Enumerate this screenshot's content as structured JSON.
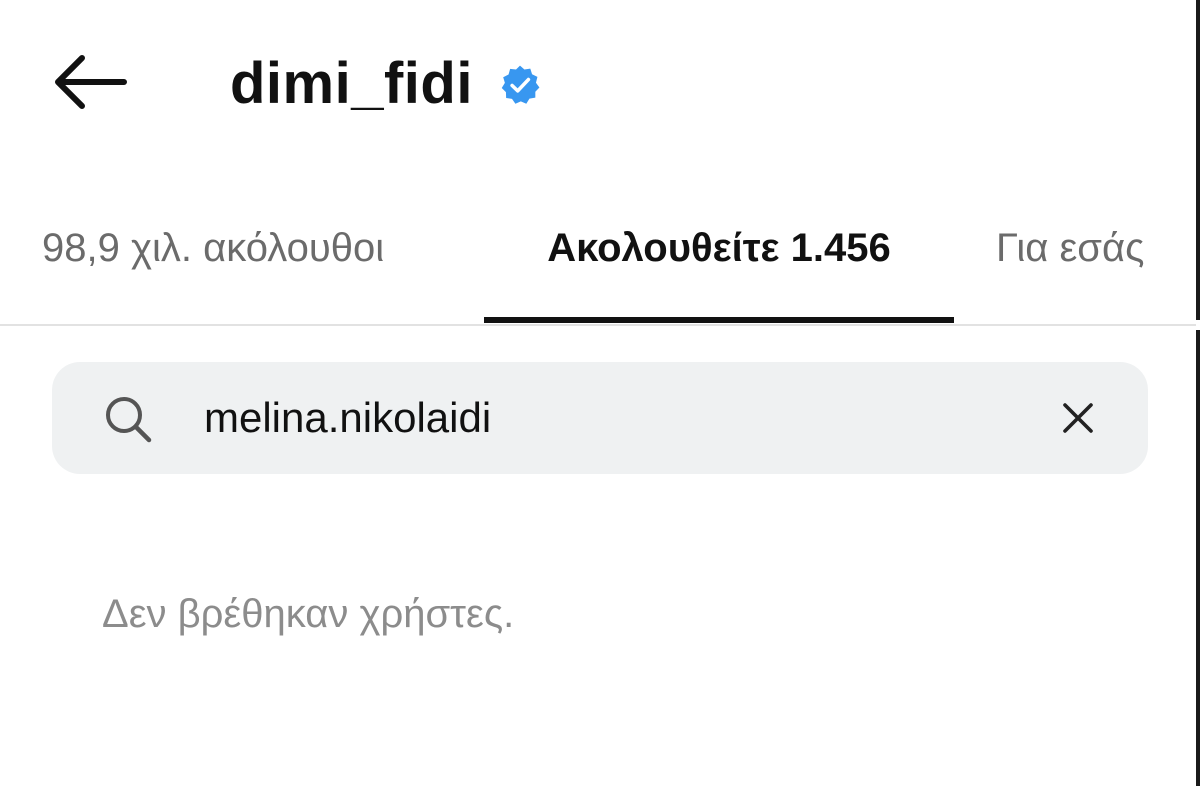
{
  "header": {
    "username": "dimi_fidi",
    "verified_icon": "verified-badge-icon",
    "back_icon": "arrow-left-icon"
  },
  "tabs": [
    {
      "label": "98,9 χιλ. ακόλουθοι",
      "active": false
    },
    {
      "label": "Ακολουθείτε 1.456",
      "active": true
    },
    {
      "label": "Για εσάς",
      "active": false
    }
  ],
  "search": {
    "icon": "search-icon",
    "value": "melina.nikolaidi",
    "clear_icon": "close-icon"
  },
  "results": {
    "empty_message": "Δεν βρέθηκαν χρήστες."
  },
  "colors": {
    "verified_blue": "#3897f0",
    "active_tab": "#111111",
    "inactive_tab": "#6b6b6b",
    "search_background": "#eff1f2",
    "empty_text": "#8c8c8c"
  }
}
